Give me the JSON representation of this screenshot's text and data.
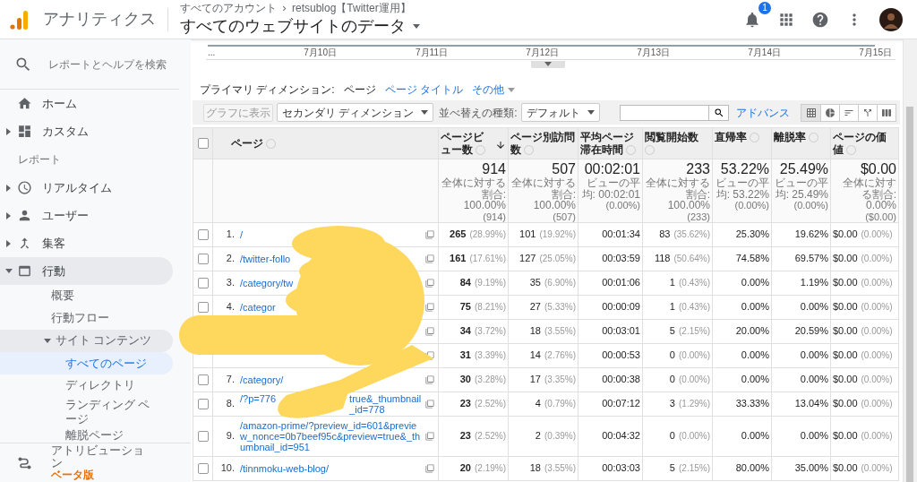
{
  "header": {
    "product": "アナリティクス",
    "breadcrumb": [
      "すべてのアカウント",
      "retsublog【Twitter運用】"
    ],
    "title": "すべてのウェブサイトのデータ",
    "notification_count": "1"
  },
  "sidebar": {
    "search_placeholder": "レポートとヘルプを検索",
    "items": [
      {
        "label": "ホーム"
      },
      {
        "label": "カスタム",
        "expanded": false
      },
      {
        "kind": "section",
        "label": "レポート"
      },
      {
        "label": "リアルタイム",
        "expanded": false
      },
      {
        "label": "ユーザー",
        "expanded": false
      },
      {
        "label": "集客",
        "expanded": false
      },
      {
        "label": "行動",
        "expanded": true,
        "children": [
          {
            "label": "概要"
          },
          {
            "label": "行動フロー"
          },
          {
            "label": "サイト コンテンツ",
            "expanded": true,
            "children": [
              {
                "label": "すべてのページ",
                "selected": true
              },
              {
                "label": "ディレクトリ",
                "selected": false
              },
              {
                "label": "ランディング ページ",
                "selected": false
              },
              {
                "label": "離脱ページ",
                "selected": false
              }
            ]
          }
        ]
      }
    ],
    "footer": {
      "label": "アトリビューション",
      "badge": "ベータ版"
    }
  },
  "timeline": {
    "ellipsis": "...",
    "dates": [
      "7月10日",
      "7月11日",
      "7月12日",
      "7月13日",
      "7月14日",
      "7月15日"
    ]
  },
  "primary_dimension": {
    "label": "プライマリ ディメンション:",
    "options": [
      {
        "label": "ページ",
        "selected": true
      },
      {
        "label": "ページ タイトル",
        "selected": false
      },
      {
        "label": "その他",
        "selected": false
      }
    ]
  },
  "toolbar": {
    "chart_button": {
      "label": "グラフに表示",
      "disabled": true
    },
    "secondary_dimension": "セカンダリ ディメンション",
    "sort_label": "並べ替えの種類:",
    "sort_value": "デフォルト",
    "advanced_link": "アドバンス",
    "views": [
      {
        "kind": "table",
        "selected": true
      },
      {
        "kind": "pie",
        "selected": false
      },
      {
        "kind": "bars",
        "selected": false
      },
      {
        "kind": "pivot",
        "selected": false
      },
      {
        "kind": "terms",
        "selected": false
      }
    ]
  },
  "table": {
    "select_all_checked": false,
    "page_column": {
      "label": "ページ"
    },
    "columns": [
      {
        "label": "ページビュー数",
        "sorted": true
      },
      {
        "label": "ページ別訪問数",
        "sorted": false
      },
      {
        "label": "平均ページ滞在時間",
        "sorted": false
      },
      {
        "label": "閲覧開始数",
        "sorted": false
      },
      {
        "label": "直帰率",
        "sorted": false
      },
      {
        "label": "離脱率",
        "sorted": false
      },
      {
        "label": "ページの価値",
        "sorted": false
      }
    ],
    "totals": [
      {
        "value": "914",
        "note": "全体に対する割合: 100.00%",
        "base": "(914)"
      },
      {
        "value": "507",
        "note": "全体に対する割合: 100.00%",
        "base": "(507)"
      },
      {
        "value": "00:02:01",
        "note": "ビューの平均: 00:02:01",
        "base": "(0.00%)"
      },
      {
        "value": "233",
        "note": "全体に対する割合: 100.00%",
        "base": "(233)"
      },
      {
        "value": "53.22%",
        "note": "ビューの平均: 53.22%",
        "base": "(0.00%)"
      },
      {
        "value": "25.49%",
        "note": "ビューの平均: 25.49%",
        "base": "(0.00%)"
      },
      {
        "value": "$0.00",
        "note": "全体に対する割合: 0.00%",
        "base": "($0.00)"
      }
    ],
    "rows": [
      {
        "checked": false,
        "index": "1.",
        "page": [
          "/"
        ],
        "cells": [
          {
            "value": "265",
            "pct": "(28.99%)"
          },
          {
            "value": "101",
            "pct": "(19.92%)"
          },
          {
            "value": "00:01:34"
          },
          {
            "value": "83",
            "pct": "(35.62%)"
          },
          {
            "value": "25.30%"
          },
          {
            "value": "19.62%"
          },
          {
            "value": "$0.00",
            "pct": "(0.00%)"
          }
        ]
      },
      {
        "checked": false,
        "index": "2.",
        "page": [
          "/twitter-follo"
        ],
        "cells": [
          {
            "value": "161",
            "pct": "(17.61%)"
          },
          {
            "value": "127",
            "pct": "(25.05%)"
          },
          {
            "value": "00:03:59"
          },
          {
            "value": "118",
            "pct": "(50.64%)"
          },
          {
            "value": "74.58%"
          },
          {
            "value": "69.57%"
          },
          {
            "value": "$0.00",
            "pct": "(0.00%)"
          }
        ]
      },
      {
        "checked": false,
        "index": "3.",
        "page": [
          "/category/tw"
        ],
        "cells": [
          {
            "value": "84",
            "pct": "(9.19%)"
          },
          {
            "value": "35",
            "pct": "(6.90%)"
          },
          {
            "value": "00:01:06"
          },
          {
            "value": "1",
            "pct": "(0.43%)"
          },
          {
            "value": "0.00%"
          },
          {
            "value": "1.19%"
          },
          {
            "value": "$0.00",
            "pct": "(0.00%)"
          }
        ]
      },
      {
        "checked": false,
        "index": "4.",
        "page": [
          "/categor"
        ],
        "cells": [
          {
            "value": "75",
            "pct": "(8.21%)"
          },
          {
            "value": "27",
            "pct": "(5.33%)"
          },
          {
            "value": "00:00:09"
          },
          {
            "value": "1",
            "pct": "(0.43%)"
          },
          {
            "value": "0.00%"
          },
          {
            "value": "0.00%"
          },
          {
            "value": "$0.00",
            "pct": "(0.00%)"
          }
        ]
      },
      {
        "cells": [
          {
            "value": "34",
            "pct": "(3.72%)"
          },
          {
            "value": "18",
            "pct": "(3.55%)"
          },
          {
            "value": "00:03:01"
          },
          {
            "value": "5",
            "pct": "(2.15%)"
          },
          {
            "value": "20.00%"
          },
          {
            "value": "20.59%"
          },
          {
            "value": "$0.00",
            "pct": "(0.00%)"
          }
        ]
      },
      {
        "cells": [
          {
            "value": "31",
            "pct": "(3.39%)"
          },
          {
            "value": "14",
            "pct": "(2.76%)"
          },
          {
            "value": "00:00:53"
          },
          {
            "value": "0",
            "pct": "(0.00%)"
          },
          {
            "value": "0.00%"
          },
          {
            "value": "0.00%"
          },
          {
            "value": "$0.00",
            "pct": "(0.00%)"
          }
        ]
      },
      {
        "checked": false,
        "index": "7.",
        "page": [
          "/category/"
        ],
        "cells": [
          {
            "value": "30",
            "pct": "(3.28%)"
          },
          {
            "value": "17",
            "pct": "(3.35%)"
          },
          {
            "value": "00:00:38"
          },
          {
            "value": "0",
            "pct": "(0.00%)"
          },
          {
            "value": "0.00%"
          },
          {
            "value": "0.00%"
          },
          {
            "value": "$0.00",
            "pct": "(0.00%)"
          }
        ]
      },
      {
        "checked": false,
        "index": "8.",
        "page": [
          "/?p=776",
          "true&_thumbnail_id=778"
        ],
        "cells": [
          {
            "value": "23",
            "pct": "(2.52%)"
          },
          {
            "value": "4",
            "pct": "(0.79%)"
          },
          {
            "value": "00:07:12"
          },
          {
            "value": "3",
            "pct": "(1.29%)"
          },
          {
            "value": "33.33%"
          },
          {
            "value": "13.04%"
          },
          {
            "value": "$0.00",
            "pct": "(0.00%)"
          }
        ]
      },
      {
        "checked": false,
        "index": "9.",
        "page": [
          "/amazon-prime/?preview_id=601&preview_nonce=0b7beef95c&preview=true&_thumbnail_id=951"
        ],
        "cells": [
          {
            "value": "23",
            "pct": "(2.52%)"
          },
          {
            "value": "2",
            "pct": "(0.39%)"
          },
          {
            "value": "00:04:32"
          },
          {
            "value": "0",
            "pct": "(0.00%)"
          },
          {
            "value": "0.00%"
          },
          {
            "value": "0.00%"
          },
          {
            "value": "$0.00",
            "pct": "(0.00%)"
          }
        ]
      },
      {
        "checked": false,
        "index": "10.",
        "page": [
          "/tinnmoku-web-blog/"
        ],
        "cells": [
          {
            "value": "20",
            "pct": "(2.19%)"
          },
          {
            "value": "18",
            "pct": "(3.55%)"
          },
          {
            "value": "00:03:03"
          },
          {
            "value": "5",
            "pct": "(2.15%)"
          },
          {
            "value": "80.00%"
          },
          {
            "value": "35.00%"
          },
          {
            "value": "$0.00",
            "pct": "(0.00%)"
          }
        ]
      }
    ]
  }
}
